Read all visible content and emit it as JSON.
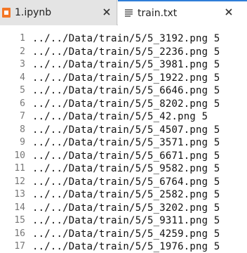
{
  "tabs": [
    {
      "label": "1.ipynb",
      "icon": "notebook-icon",
      "active": false
    },
    {
      "label": "train.txt",
      "icon": "text-file-icon",
      "active": true
    }
  ],
  "editor": {
    "lines": [
      {
        "number": "1",
        "text": "../../Data/train/5/5_3192.png 5"
      },
      {
        "number": "2",
        "text": "../../Data/train/5/5_2236.png 5"
      },
      {
        "number": "3",
        "text": "../../Data/train/5/5_3981.png 5"
      },
      {
        "number": "4",
        "text": "../../Data/train/5/5_1922.png 5"
      },
      {
        "number": "5",
        "text": "../../Data/train/5/5_6646.png 5"
      },
      {
        "number": "6",
        "text": "../../Data/train/5/5_8202.png 5"
      },
      {
        "number": "7",
        "text": "../../Data/train/5/5_42.png 5"
      },
      {
        "number": "8",
        "text": "../../Data/train/5/5_4507.png 5"
      },
      {
        "number": "9",
        "text": "../../Data/train/5/5_3571.png 5"
      },
      {
        "number": "10",
        "text": "../../Data/train/5/5_6671.png 5"
      },
      {
        "number": "11",
        "text": "../../Data/train/5/5_9582.png 5"
      },
      {
        "number": "12",
        "text": "../../Data/train/5/5_6764.png 5"
      },
      {
        "number": "13",
        "text": "../../Data/train/5/5_2582.png 5"
      },
      {
        "number": "14",
        "text": "../../Data/train/5/5_3202.png 5"
      },
      {
        "number": "15",
        "text": "../../Data/train/5/5_9311.png 5"
      },
      {
        "number": "16",
        "text": "../../Data/train/5/5_4259.png 5"
      },
      {
        "number": "17",
        "text": "../../Data/train/5/5_1976.png 5"
      }
    ]
  },
  "colors": {
    "accent": "#2f7ed8",
    "notebook_icon": "#f37726"
  }
}
